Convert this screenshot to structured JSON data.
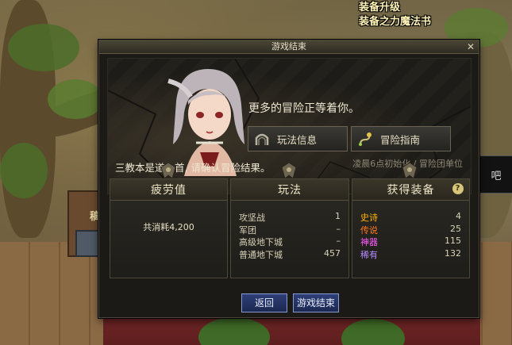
{
  "hud": {
    "line1": "装备升级",
    "line2": "装备之力魔法书",
    "side_sign": "吧",
    "left_sign": "稿"
  },
  "dialog": {
    "title": "游戏结束",
    "tagline": "更多的冒险正等着你。",
    "btn_info": "玩法信息",
    "btn_guide": "冒险指南",
    "notice": "三教本是道为首,  请确认冒险结果。",
    "reset_note": "凌晨6点初始化 / 冒险团单位"
  },
  "fatigue": {
    "title": "疲劳值",
    "consumed": "共消耗4,200"
  },
  "modes": {
    "title": "玩法",
    "rows": [
      {
        "name": "攻坚战",
        "value": "1"
      },
      {
        "name": "军团",
        "value": "–"
      },
      {
        "name": "高级地下城",
        "value": "–"
      },
      {
        "name": "普通地下城",
        "value": "457"
      }
    ]
  },
  "loot": {
    "title": "获得装备",
    "help": "?",
    "rows": [
      {
        "name": "史诗",
        "value": "4",
        "color": "#ffb400"
      },
      {
        "name": "传说",
        "value": "25",
        "color": "#ff7a1a"
      },
      {
        "name": "神器",
        "value": "115",
        "color": "#ff5cff"
      },
      {
        "name": "稀有",
        "value": "132",
        "color": "#b58cff"
      }
    ]
  },
  "footer": {
    "back": "返回",
    "end": "游戏结束"
  }
}
